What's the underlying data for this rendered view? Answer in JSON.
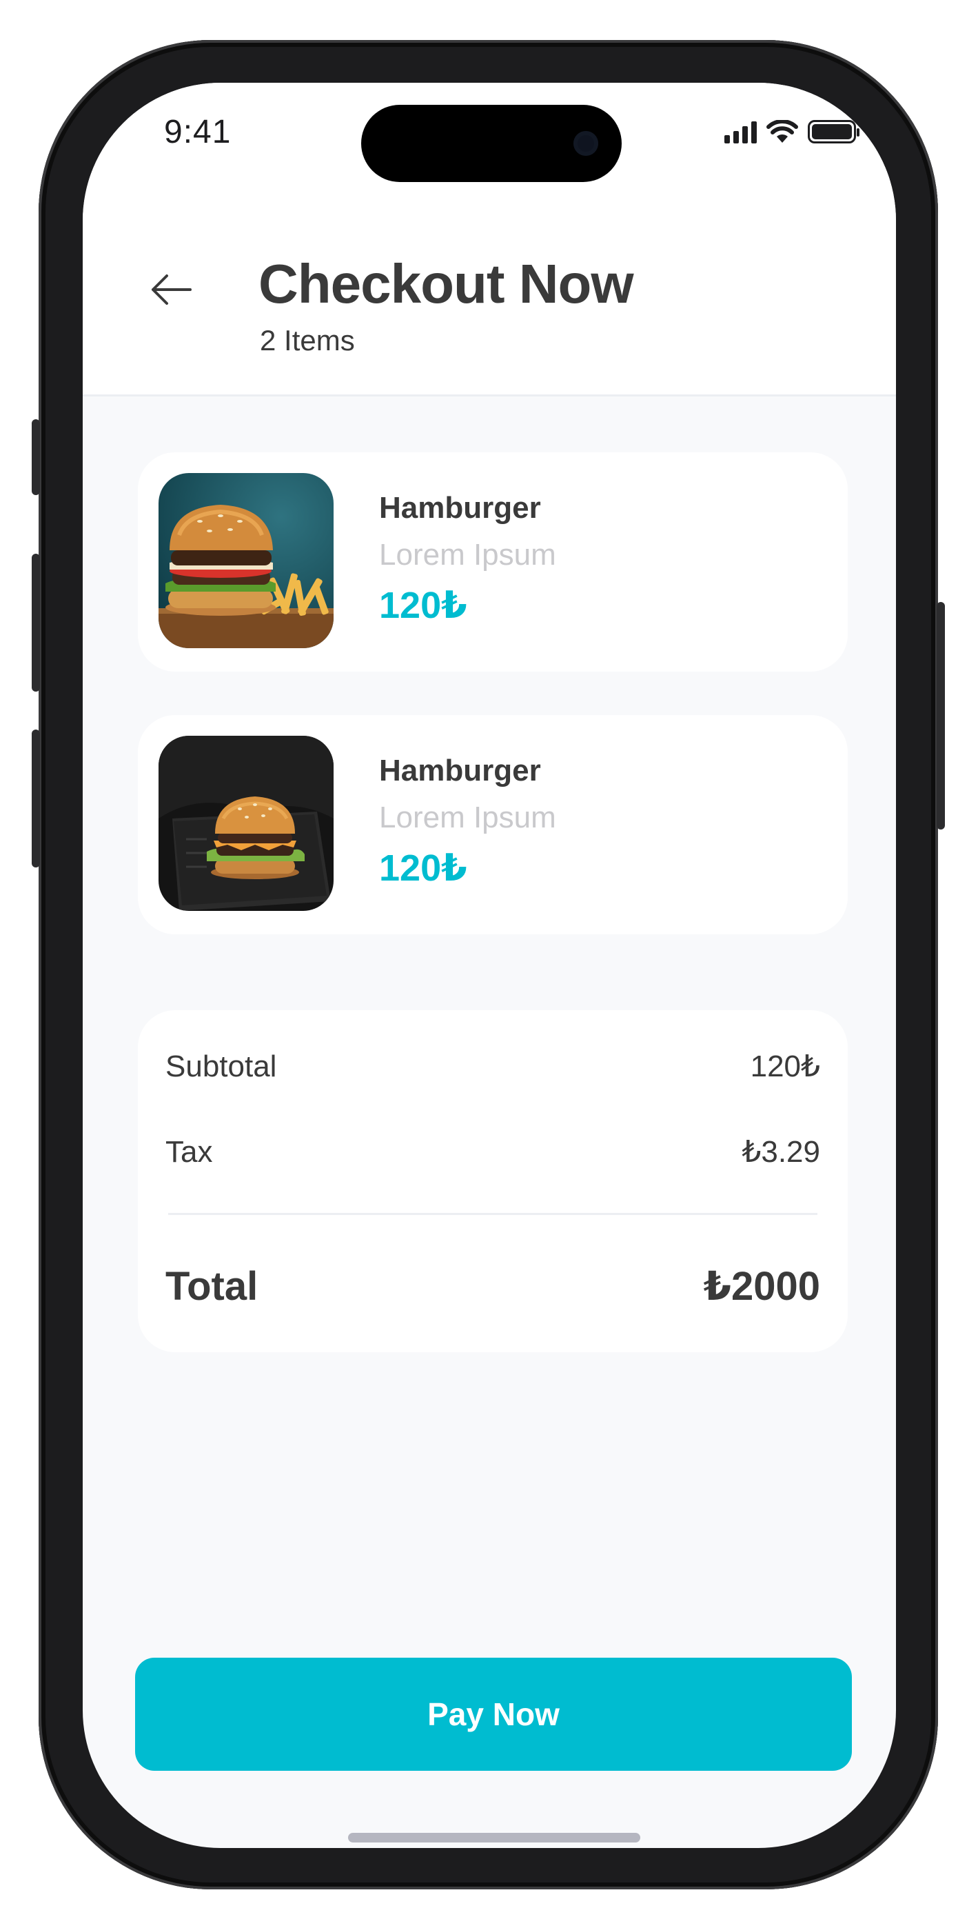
{
  "status_bar": {
    "time": "9:41"
  },
  "header": {
    "title": "Checkout Now",
    "subtitle": "2 Items"
  },
  "items": [
    {
      "name": "Hamburger",
      "description": "Lorem Ipsum",
      "price": "120₺",
      "image": "burger-with-fries-photo"
    },
    {
      "name": "Hamburger",
      "description": "Lorem Ipsum",
      "price": "120₺",
      "image": "burger-on-dark-board-photo"
    }
  ],
  "summary": {
    "subtotal_label": "Subtotal",
    "subtotal_value": "120₺",
    "tax_label": "Tax",
    "tax_value": "₺3.29",
    "total_label": "Total",
    "total_value": "₺2000"
  },
  "pay_button": {
    "label": "Pay Now"
  },
  "colors": {
    "accent": "#00bcd0",
    "text": "#3a3a3a",
    "muted": "#c9c9cc",
    "background": "#f8f9fb"
  },
  "icons": [
    "back-arrow-icon",
    "cellular-signal-icon",
    "wifi-icon",
    "battery-icon"
  ]
}
